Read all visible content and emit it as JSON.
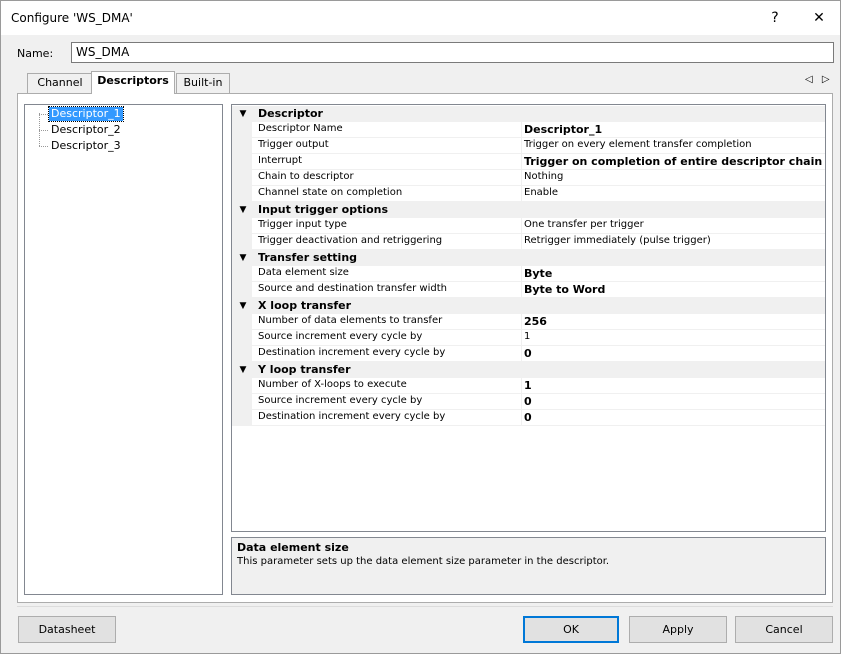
{
  "window": {
    "title": "Configure 'WS_DMA'",
    "help_glyph": "?",
    "close_glyph": "✕"
  },
  "name_field": {
    "label": "Name:",
    "value": "WS_DMA"
  },
  "tabs": [
    {
      "label": "Channel"
    },
    {
      "label": "Descriptors"
    },
    {
      "label": "Built-in"
    }
  ],
  "tab_arrows": "◁ ▷",
  "tree": {
    "items": [
      {
        "label": "Descriptor_1"
      },
      {
        "label": "Descriptor_2"
      },
      {
        "label": "Descriptor_3"
      }
    ],
    "selected": "Descriptor_1"
  },
  "properties": {
    "descriptor": {
      "label": "Descriptor",
      "rows": [
        {
          "name": "Descriptor Name",
          "value": "Descriptor_1"
        },
        {
          "name": "Trigger output",
          "value": "Trigger on every element transfer completion"
        },
        {
          "name": "Interrupt",
          "value": "Trigger on completion of entire descriptor chain"
        },
        {
          "name": "Chain to descriptor",
          "value": "Nothing"
        },
        {
          "name": "Channel state on completion",
          "value": "Enable"
        }
      ]
    },
    "input_trigger": {
      "label": "Input trigger options",
      "rows": [
        {
          "name": "Trigger input type",
          "value": "One transfer per trigger"
        },
        {
          "name": "Trigger deactivation and retriggering",
          "value": "Retrigger immediately (pulse trigger)"
        }
      ]
    },
    "transfer_setting": {
      "label": "Transfer setting",
      "rows": [
        {
          "name": "Data element size",
          "value": "Byte"
        },
        {
          "name": "Source and destination transfer width",
          "value": "Byte to Word"
        }
      ]
    },
    "x_loop": {
      "label": "X loop transfer",
      "rows": [
        {
          "name": "Number of data elements to transfer",
          "value": "256"
        },
        {
          "name": "Source increment every cycle by",
          "value": "1"
        },
        {
          "name": "Destination increment every cycle by",
          "value": "0"
        }
      ]
    },
    "y_loop": {
      "label": "Y loop transfer",
      "rows": [
        {
          "name": "Number of X-loops to execute",
          "value": "1"
        },
        {
          "name": "Source increment every cycle by",
          "value": "0"
        },
        {
          "name": "Destination increment every cycle by",
          "value": "0"
        }
      ]
    }
  },
  "help": {
    "title": "Data element size",
    "text": "This parameter sets up the data element size parameter in the descriptor."
  },
  "buttons": {
    "datasheet": "Datasheet",
    "ok": "OK",
    "apply": "Apply",
    "cancel": "Cancel"
  },
  "icons": {
    "collapse": "collapse-arrow-icon",
    "help": "help-icon",
    "close": "close-icon",
    "tab_scroll": "tab-scroll-icon"
  },
  "colors": {
    "selection": "#3399ff",
    "default_button_border": "#0078d7"
  }
}
